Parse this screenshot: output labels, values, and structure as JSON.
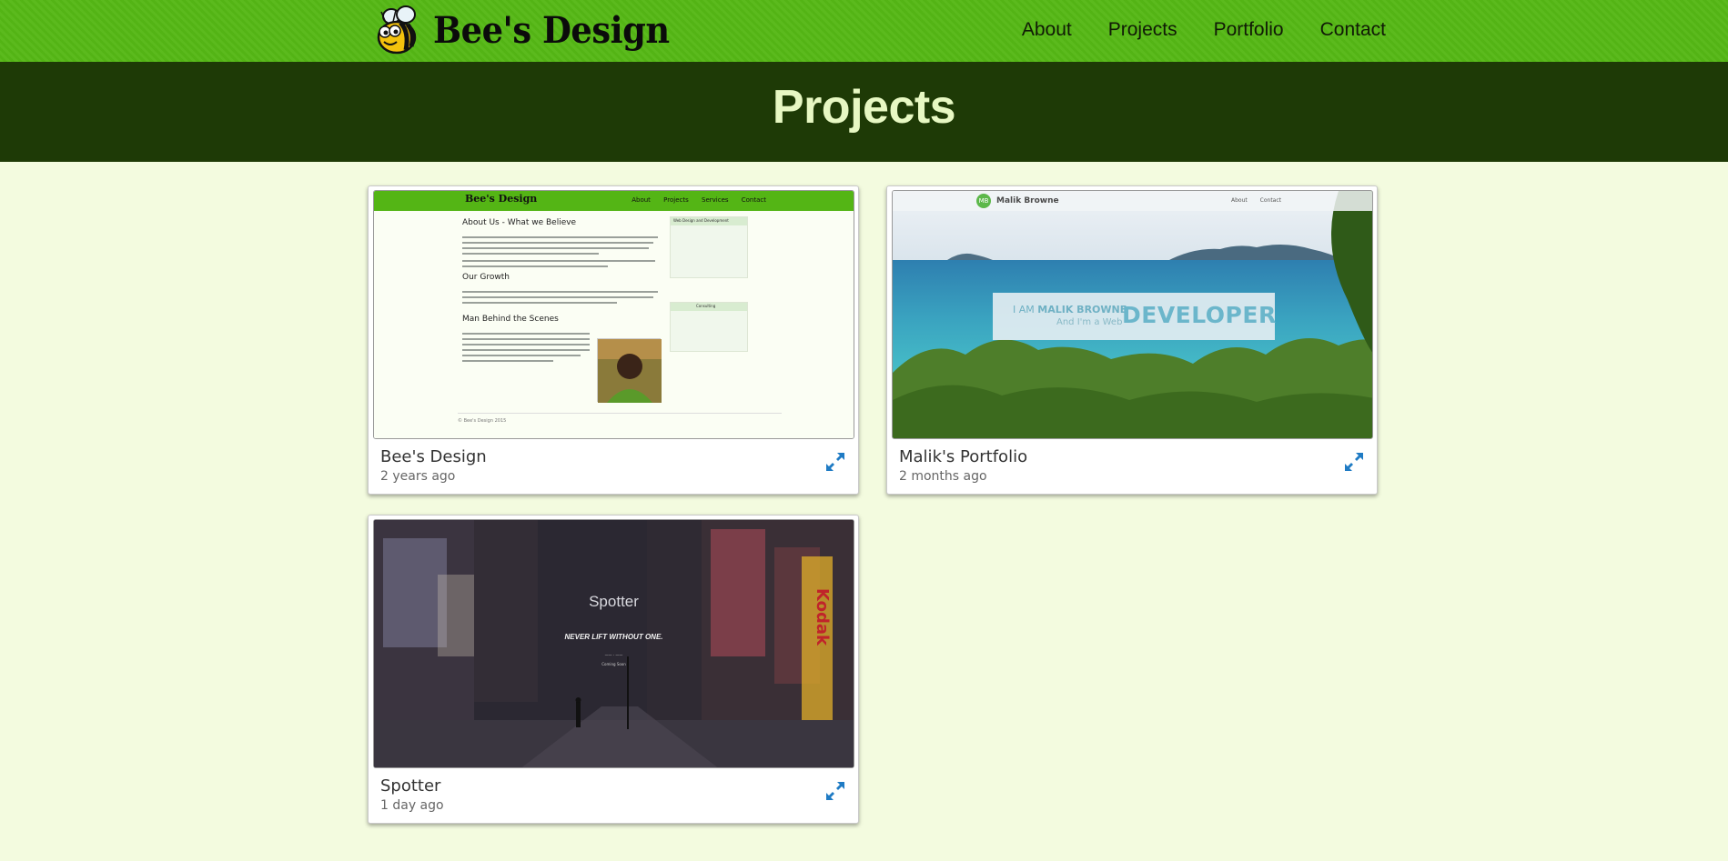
{
  "header": {
    "brand_name": "Bee's Design",
    "nav": [
      "About",
      "Projects",
      "Portfolio",
      "Contact"
    ]
  },
  "hero": {
    "title": "Projects"
  },
  "projects": [
    {
      "title": "Bee's Design",
      "time": "2 years ago",
      "preview": {
        "logo": "Bee's Design",
        "nav": [
          "About",
          "Projects",
          "Services",
          "Contact"
        ],
        "headings": [
          "About Us - What we Believe",
          "Our Growth",
          "Man Behind the Scenes"
        ],
        "sidebar": [
          "Web Design and Development",
          "Consulting"
        ],
        "footer": "© Bee's Design 2015"
      }
    },
    {
      "title": "Malik's Portfolio",
      "time": "2 months ago",
      "preview": {
        "logo_initials": "MB",
        "site_name": "Malik Browne",
        "nav": [
          "About",
          "Contact"
        ],
        "hero_prefix": "I AM",
        "hero_name": "MALIK BROWNE",
        "hero_line": "And I'm a Web",
        "hero_word": "DEVELOPER"
      }
    },
    {
      "title": "Spotter",
      "time": "1 day ago",
      "preview": {
        "app_name": "Spotter",
        "tagline": "NEVER LIFT WITHOUT ONE.",
        "sub1": "—— · ——",
        "sub2": "Coming Soon"
      }
    }
  ],
  "colors": {
    "topbar": "#55b715",
    "hero_bg": "#1e3a06",
    "hero_text": "#e7f8c3",
    "page_bg": "#f3fbdf",
    "expand_icon": "#1f7bc4"
  },
  "icons": {
    "logo": "bee-icon",
    "expand": "expand-icon"
  }
}
